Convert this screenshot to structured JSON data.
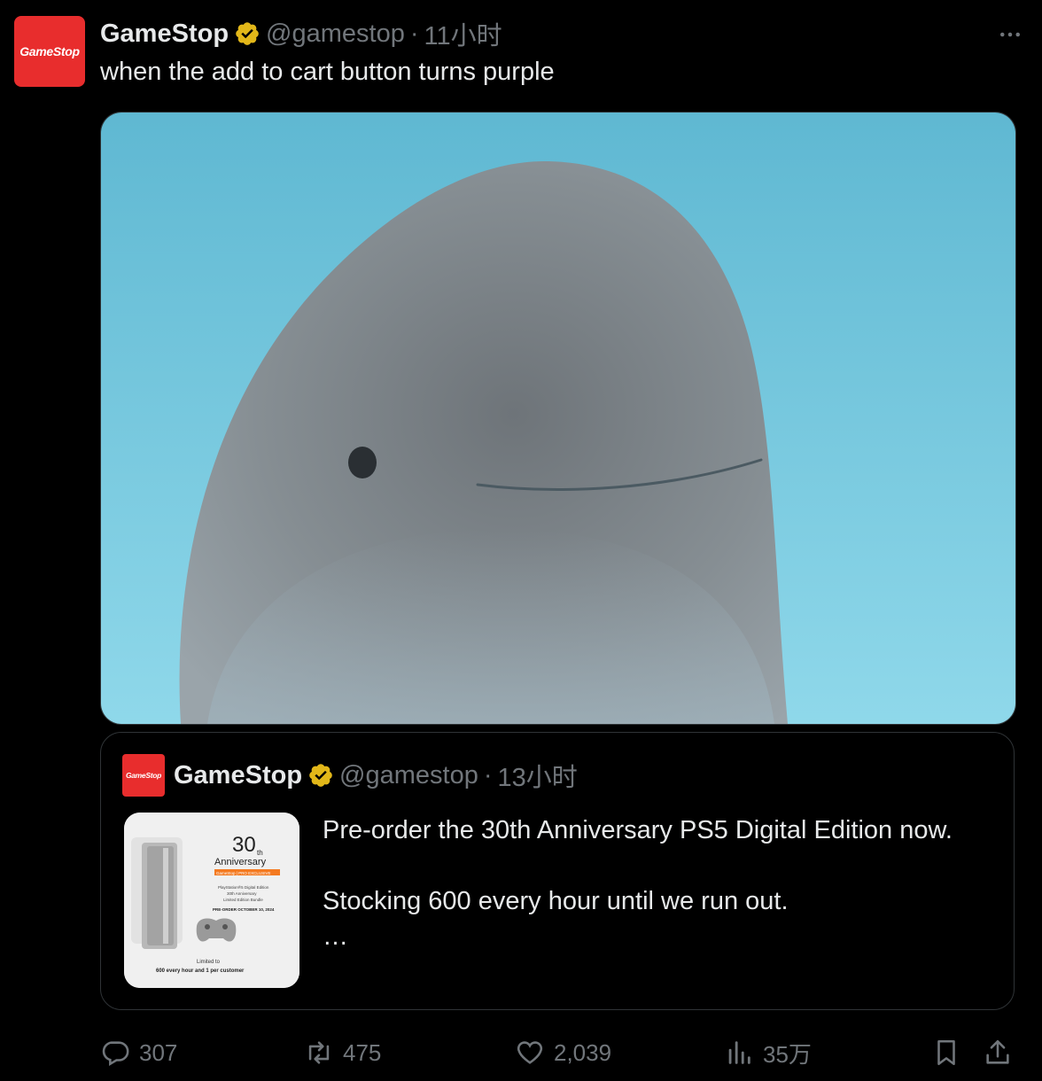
{
  "colors": {
    "brand_red": "#e82d2d",
    "verified_gold": "#e2b719",
    "muted": "#71767b"
  },
  "post": {
    "avatar_logo": "GameStop",
    "author_name": "GameStop",
    "handle": "@gamestop",
    "separator": "·",
    "time": "11小时",
    "text": "when the add to cart button turns purple",
    "more_icon": "more-dots-icon"
  },
  "quoted": {
    "avatar_logo": "GameStop",
    "author_name": "GameStop",
    "handle": "@gamestop",
    "separator": "·",
    "time": "13小时",
    "line1": "Pre-order the 30th Anniversary PS5 Digital Edition now.",
    "line2": "Stocking 600 every hour until we run out.",
    "ellipsis": "…",
    "thumbnail": {
      "big_number": "30",
      "ordinal": "th",
      "anniversary": "Anniversary",
      "retailer_tag": "GameStop | PRO EXCLUSIVE",
      "product_line1": "PlayStation®5 Digital Edition",
      "product_line2": "30th Anniversary",
      "product_line3": "Limited Edition Bundle",
      "preorder": "PRE-ORDER OCTOBER 10, 2024",
      "limited": "Limited to",
      "limit_detail": "600 every hour and 1 per customer"
    }
  },
  "actions": {
    "replies": "307",
    "reposts": "475",
    "likes": "2,039",
    "views": "35万"
  }
}
